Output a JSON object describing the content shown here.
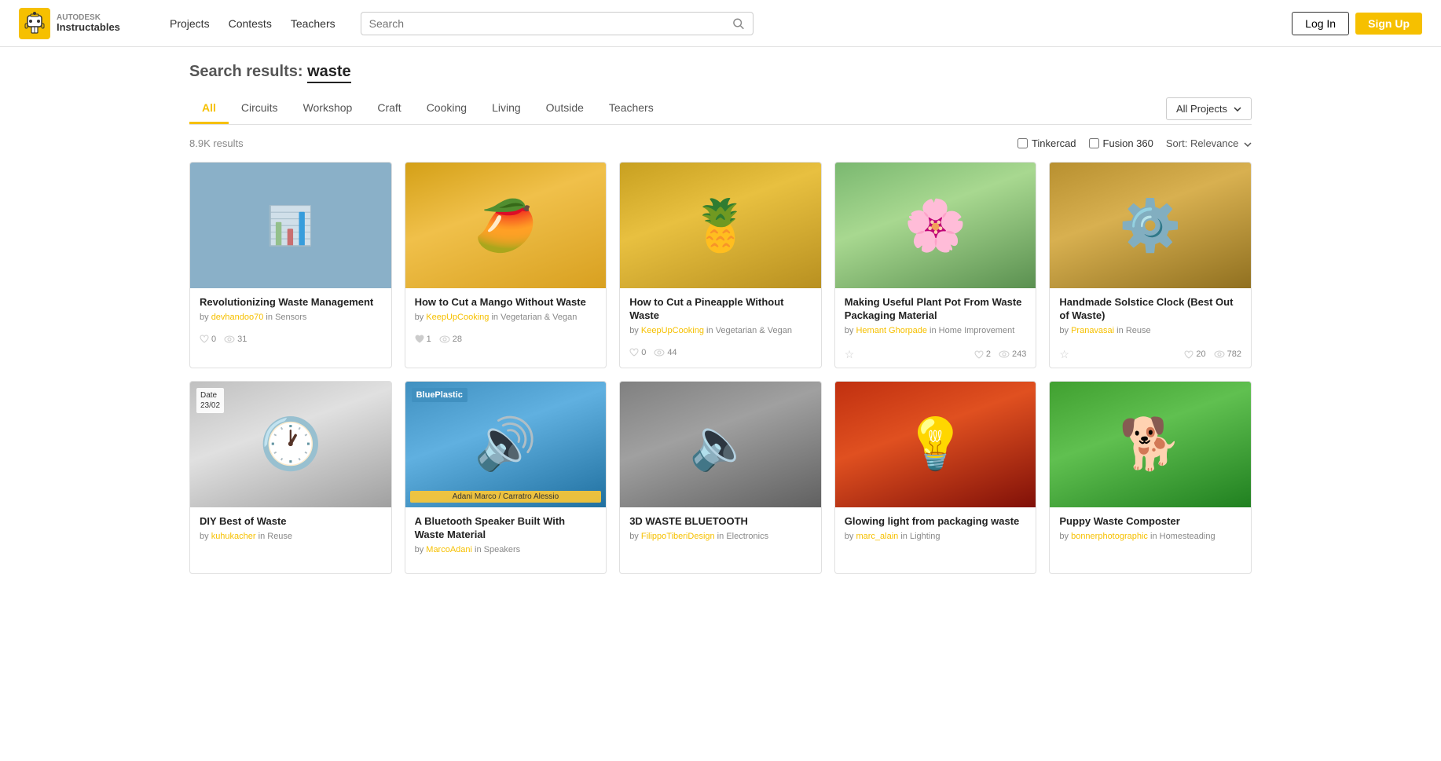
{
  "header": {
    "logo_autodesk": "AUTODESK",
    "logo_instructables": "Instructables",
    "nav": [
      {
        "label": "Projects"
      },
      {
        "label": "Contests"
      },
      {
        "label": "Teachers"
      }
    ],
    "search_placeholder": "Search",
    "login_label": "Log In",
    "signup_label": "Sign Up"
  },
  "search": {
    "title": "Search results:",
    "query": "waste",
    "results_count": "8.9K results"
  },
  "filter_tabs": [
    {
      "label": "All",
      "active": true
    },
    {
      "label": "Circuits",
      "active": false
    },
    {
      "label": "Workshop",
      "active": false
    },
    {
      "label": "Craft",
      "active": false
    },
    {
      "label": "Cooking",
      "active": false
    },
    {
      "label": "Living",
      "active": false
    },
    {
      "label": "Outside",
      "active": false
    },
    {
      "label": "Teachers",
      "active": false
    }
  ],
  "filter_dropdown_label": "All Projects",
  "sort_label": "Sort: Relevance",
  "tinkercad_label": "Tinkercad",
  "fusion360_label": "Fusion 360",
  "cards_row1": [
    {
      "title": "Revolutionizing Waste Management",
      "author": "devhandoo70",
      "category": "Sensors",
      "likes": "0",
      "views": "31",
      "img_class": "img-waste-mgmt",
      "has_star": false
    },
    {
      "title": "How to Cut a Mango Without Waste",
      "author": "KeepUpCooking",
      "category": "Vegetarian & Vegan",
      "likes": "1",
      "views": "28",
      "img_class": "img-mango",
      "has_star": false
    },
    {
      "title": "How to Cut a Pineapple Without Waste",
      "author": "KeepUpCooking",
      "category": "Vegetarian & Vegan",
      "likes": "0",
      "views": "44",
      "img_class": "img-pineapple",
      "has_star": false
    },
    {
      "title": "Making Useful Plant Pot From Waste Packaging Material",
      "author": "Hemant Ghorpade",
      "category": "Home Improvement",
      "likes": "2",
      "views": "243",
      "img_class": "img-plant",
      "has_star": true
    },
    {
      "title": "Handmade Solstice Clock (Best Out of Waste)",
      "author": "Pranavasai",
      "category": "Reuse",
      "likes": "20",
      "views": "782",
      "img_class": "img-clock",
      "has_star": true
    }
  ],
  "cards_row2": [
    {
      "title": "DIY Best of Waste",
      "author": "kuhukacher",
      "category": "Reuse",
      "likes": "",
      "views": "",
      "img_class": "img-diy-clock",
      "has_star": false,
      "has_date_label": true,
      "date_label": "Date\n23/02"
    },
    {
      "title": "A Bluetooth Speaker Built With Waste Material",
      "author": "MarcoAdani",
      "category": "Speakers",
      "likes": "",
      "views": "",
      "img_class": "img-bluetooth",
      "has_star": false,
      "has_blue_plastic": true,
      "maker_label": "Adani Marco / Carratro Alessio"
    },
    {
      "title": "3D WASTE BLUETOOTH",
      "author": "FilippoTiberiDesign",
      "category": "Electronics",
      "likes": "",
      "views": "",
      "img_class": "img-3d-bluetooth",
      "has_star": false
    },
    {
      "title": "Glowing light from packaging waste",
      "author": "marc_alain",
      "category": "Lighting",
      "likes": "",
      "views": "",
      "img_class": "img-glow",
      "has_star": false
    },
    {
      "title": "Puppy Waste Composter",
      "author": "bonnerphotographic",
      "category": "Homesteading",
      "likes": "",
      "views": "",
      "img_class": "img-puppy",
      "has_star": false
    }
  ]
}
